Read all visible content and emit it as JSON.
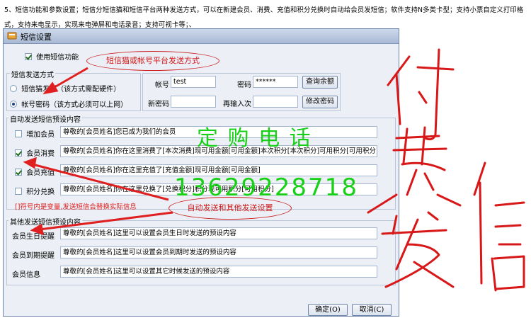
{
  "intro_text": "5、短信功能和参数设置；短信分短信猫和短信平台两种发送方式，可以在新建会员、消费、充值和积分兑换时自动给会员发短信；软件支持N多类卡型；支持小票自定义打印格式，支持来电显示，实现来电弹屏和电话录音；支持可视卡等；、",
  "window": {
    "title": "短信设置"
  },
  "use_sms": {
    "label": "使用短信功能",
    "checked": true
  },
  "send_mode": {
    "legend": "短信发送方式",
    "option_modem": "短信猫发送（该方式需配硬件）",
    "option_account": "帐号密码（该方式必须可以上网）",
    "selected": "account"
  },
  "account": {
    "account_label": "帐号",
    "account_value": "test",
    "password_label": "密码",
    "password_value": "******",
    "query_balance_button": "查询余额",
    "new_password_label": "新密码",
    "confirm_label": "再输入次",
    "change_password_button": "修改密码"
  },
  "auto_section": {
    "legend": "自动发送短信预设内容",
    "rows": [
      {
        "label": "增加会员",
        "checked": false,
        "text": "尊敬的[会员姓名]您已成为我们的会员"
      },
      {
        "label": "会员消费",
        "checked": true,
        "text": "尊敬的[会员姓名]你在这里消费了[本次消费]现可用金额[可用金额]本次积分[本次积分]可用积分[可用积分]"
      },
      {
        "label": "会员充值",
        "checked": true,
        "text": "尊敬的[会员姓名]你在这里充值了[充值金额]现可用金额[可用金额]"
      },
      {
        "label": "积分兑换",
        "checked": false,
        "text": "尊敬的[会员姓名]你在这里兑换了[兑换积分]积分现可用积分[可用积分]"
      }
    ],
    "note": "[]符号内是变量,发送短信会替换实际信息"
  },
  "other_section": {
    "legend": "其他发送短信预设内容",
    "rows": [
      {
        "label": "会员生日提醒",
        "text": "尊敬的[会员姓名]这里可以设置会员生日时发送的预设内容"
      },
      {
        "label": "会员到期提醒",
        "text": "尊敬的[会员姓名]这里可以设置会员到期时发送的预设内容"
      },
      {
        "label": "会员信息",
        "text": "尊敬的[会员姓名]这里可以设置其它时候发送的预设内容"
      }
    ]
  },
  "buttons": {
    "ok": "确定(O)",
    "cancel": "取消(C)"
  },
  "overlay": {
    "callout_send_mode": "短信猫或帐号平台发送方式",
    "callout_auto": "自动发送和其他发送设置",
    "green_order": "定 购 电 话",
    "green_phone": "13629228718",
    "handwriting": "付费发信"
  },
  "colors": {
    "annotation_red": "#e02020",
    "phone_green": "#18d018",
    "titlebar": "#b9c8e0"
  }
}
